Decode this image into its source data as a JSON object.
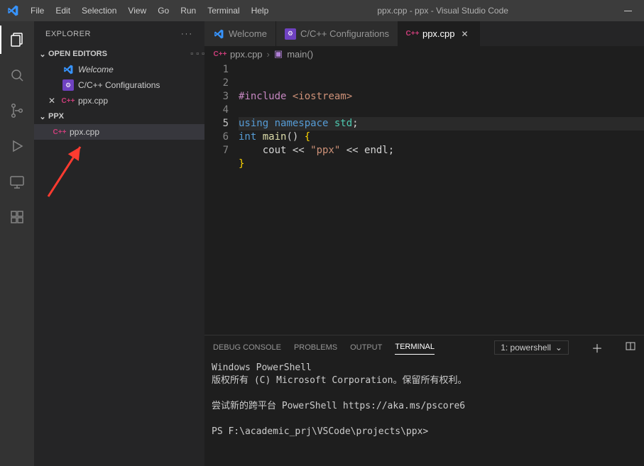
{
  "titlebar": {
    "menus": [
      "File",
      "Edit",
      "Selection",
      "View",
      "Go",
      "Run",
      "Terminal",
      "Help"
    ],
    "title": "ppx.cpp - ppx - Visual Studio Code"
  },
  "activitybar": {
    "items": [
      {
        "name": "explorer-icon",
        "active": true
      },
      {
        "name": "search-icon",
        "active": false
      },
      {
        "name": "source-control-icon",
        "active": false
      },
      {
        "name": "run-debug-icon",
        "active": false
      },
      {
        "name": "remote-icon",
        "active": false
      },
      {
        "name": "extensions-icon",
        "active": false
      }
    ]
  },
  "sidebar": {
    "title": "EXPLORER",
    "openEditors": {
      "header": "OPEN EDITORS",
      "items": [
        {
          "icon": "vscode",
          "label": "Welcome",
          "closable": false,
          "italic": true
        },
        {
          "icon": "gear",
          "label": "C/C++ Configurations",
          "closable": false
        },
        {
          "icon": "cpp",
          "label": "ppx.cpp",
          "closable": true
        }
      ]
    },
    "folder": {
      "header": "PPX",
      "items": [
        {
          "icon": "cpp",
          "label": "ppx.cpp",
          "active": true
        }
      ]
    }
  },
  "editor": {
    "tabs": [
      {
        "icon": "vscode",
        "label": "Welcome",
        "active": false
      },
      {
        "icon": "gear",
        "label": "C/C++ Configurations",
        "active": false
      },
      {
        "icon": "cpp",
        "label": "ppx.cpp",
        "active": true,
        "close": "✕"
      }
    ],
    "breadcrumbs": {
      "file_icon": "cpp",
      "file": "ppx.cpp",
      "symbol_icon": "cube",
      "symbol": "main()"
    },
    "lines": [
      "1",
      "2",
      "3",
      "4",
      "5",
      "6",
      "7"
    ],
    "highlight_line": 5,
    "code_tokens": {
      "l1_a": "#include",
      "l1_b": " <iostream>",
      "l3_a": "using",
      "l3_b": " namespace",
      "l3_c": " std",
      "l3_d": ";",
      "l4_a": "int",
      "l4_b": " main",
      "l4_c": "()",
      "l4_d": " {",
      "l5_a": "    cout ",
      "l5_b": "<<",
      "l5_c": " \"ppx\"",
      "l5_d": " << ",
      "l5_e": "endl",
      "l5_f": ";",
      "l6_a": "}"
    }
  },
  "panel": {
    "tabs": [
      "DEBUG CONSOLE",
      "PROBLEMS",
      "OUTPUT",
      "TERMINAL"
    ],
    "active_tab": "TERMINAL",
    "terminal_selector": "1: powershell",
    "terminal": {
      "line1": "Windows PowerShell",
      "line2": "版权所有 (C) Microsoft Corporation。保留所有权利。",
      "line3": "尝试新的跨平台 PowerShell https://aka.ms/pscore6",
      "line4": "PS F:\\academic_prj\\VSCode\\projects\\ppx>"
    }
  }
}
